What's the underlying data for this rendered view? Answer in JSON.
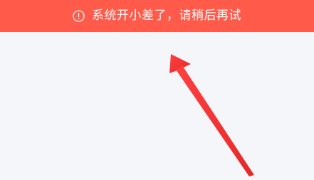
{
  "banner": {
    "icon": "exclamation-circle-icon",
    "message": "系统开小差了，请稍后再试",
    "background_color": "#ff5a4a",
    "text_color": "#ffffff"
  },
  "page": {
    "background_color": "#f5f6fa"
  },
  "annotation": {
    "icon": "red-pointer-arrow",
    "color": "#ff3b3b"
  }
}
